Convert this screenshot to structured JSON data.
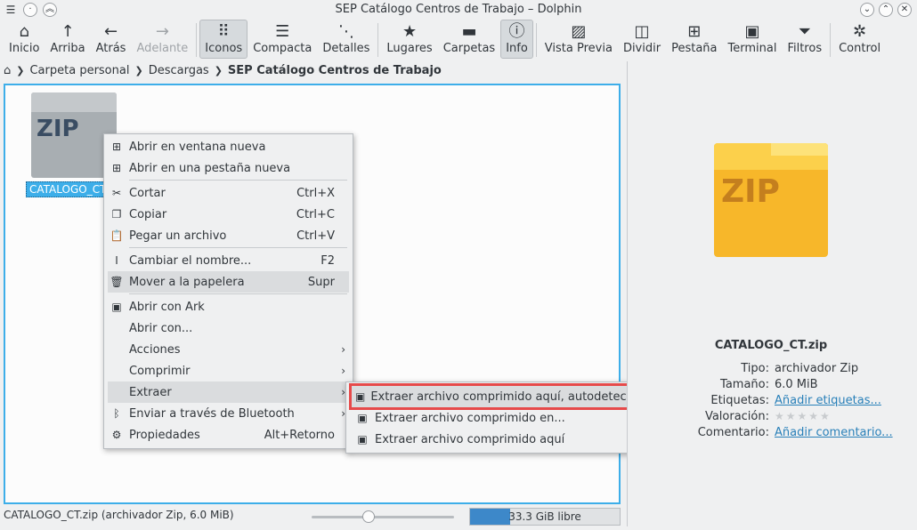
{
  "window": {
    "title": "SEP Catálogo Centros de Trabajo – Dolphin"
  },
  "toolbar": [
    {
      "label": "Inicio",
      "icon": "home-icon",
      "glyph": "⌂"
    },
    {
      "label": "Arriba",
      "icon": "arrow-up-icon",
      "glyph": "↑"
    },
    {
      "label": "Atrás",
      "icon": "arrow-left-icon",
      "glyph": "←"
    },
    {
      "label": "Adelante",
      "icon": "arrow-right-icon",
      "glyph": "→",
      "disabled": true
    },
    {
      "label": "Iconos",
      "icon": "icons-view-icon",
      "glyph": "⠿",
      "active": true
    },
    {
      "label": "Compacta",
      "icon": "compact-view-icon",
      "glyph": "☰"
    },
    {
      "label": "Detalles",
      "icon": "details-view-icon",
      "glyph": "⋱"
    },
    {
      "label": "Lugares",
      "icon": "star-icon",
      "glyph": "★"
    },
    {
      "label": "Carpetas",
      "icon": "folder-icon",
      "glyph": "▬"
    },
    {
      "label": "Info",
      "icon": "info-icon",
      "glyph": "ⓘ",
      "active": true
    },
    {
      "label": "Vista Previa",
      "icon": "preview-icon",
      "glyph": "▨"
    },
    {
      "label": "Dividir",
      "icon": "split-icon",
      "glyph": "◫"
    },
    {
      "label": "Pestaña",
      "icon": "new-tab-icon",
      "glyph": "⊞"
    },
    {
      "label": "Terminal",
      "icon": "terminal-icon",
      "glyph": "▣"
    },
    {
      "label": "Filtros",
      "icon": "filter-icon",
      "glyph": "⏷"
    },
    {
      "label": "Control",
      "icon": "control-icon",
      "glyph": "✲"
    }
  ],
  "breadcrumb": {
    "items": [
      "Carpeta personal",
      "Descargas",
      "SEP Catálogo Centros de Trabajo"
    ]
  },
  "file": {
    "name": "CATALOGO_CT.zip",
    "icon_label": "ZIP",
    "truncated_name": "CATALOGO_CT."
  },
  "context_menu": {
    "items": [
      {
        "label": "Abrir en ventana nueva",
        "icon": "new-window-icon",
        "glyph": "⊞"
      },
      {
        "label": "Abrir en una pestaña nueva",
        "icon": "new-tab-icon",
        "glyph": "⊞"
      },
      {
        "sep": true
      },
      {
        "label": "Cortar",
        "key": "Ctrl+X",
        "icon": "cut-icon",
        "glyph": "✂"
      },
      {
        "label": "Copiar",
        "key": "Ctrl+C",
        "icon": "copy-icon",
        "glyph": "❐"
      },
      {
        "label": "Pegar un archivo",
        "key": "Ctrl+V",
        "icon": "paste-icon",
        "glyph": "📋"
      },
      {
        "sep": true
      },
      {
        "label": "Cambiar el nombre...",
        "key": "F2",
        "icon": "rename-icon",
        "glyph": "I"
      },
      {
        "label": "Mover a la papelera",
        "key": "Supr",
        "icon": "trash-icon",
        "glyph": "🗑",
        "highlight": true
      },
      {
        "sep": true
      },
      {
        "label": "Abrir con Ark",
        "icon": "ark-icon",
        "glyph": "▣"
      },
      {
        "label": "Abrir con...",
        "icon": "",
        "glyph": ""
      },
      {
        "label": "Acciones",
        "submenu": true,
        "icon": "",
        "glyph": ""
      },
      {
        "label": "Comprimir",
        "submenu": true,
        "icon": "",
        "glyph": ""
      },
      {
        "label": "Extraer",
        "submenu": true,
        "icon": "",
        "glyph": "",
        "highlight": true
      },
      {
        "label": "Enviar a través de Bluetooth",
        "submenu": true,
        "icon": "bluetooth-icon",
        "glyph": "ᛒ"
      },
      {
        "label": "Propiedades",
        "key": "Alt+Retorno",
        "icon": "properties-icon",
        "glyph": "⚙"
      }
    ]
  },
  "submenu": {
    "items": [
      {
        "label": "Extraer archivo comprimido aquí, autodetectar subcarpeta",
        "boxed": true
      },
      {
        "label": "Extraer archivo comprimido en..."
      },
      {
        "label": "Extraer archivo comprimido aquí"
      }
    ]
  },
  "info_panel": {
    "icon_label": "ZIP",
    "filename": "CATALOGO_CT.zip",
    "props": [
      {
        "key": "Tipo:",
        "value": "archivador Zip"
      },
      {
        "key": "Tamaño:",
        "value": "6.0 MiB"
      },
      {
        "key": "Etiquetas:",
        "value": "Añadir etiquetas...",
        "link": true
      },
      {
        "key": "Valoración:",
        "value": "★★★★★",
        "stars": true
      },
      {
        "key": "Comentario:",
        "value": "Añadir comentario...",
        "link": true
      }
    ]
  },
  "statusbar": {
    "text": "CATALOGO_CT.zip (archivador Zip, 6.0 MiB)",
    "zoom_fraction": 0.4,
    "free_text": "33.3 GiB libre",
    "free_used_fraction": 0.27
  },
  "colors": {
    "accent": "#3daee9",
    "zip_yellow": "#f7b72a",
    "link": "#2980b9",
    "highlight_box": "#e64a4a"
  }
}
